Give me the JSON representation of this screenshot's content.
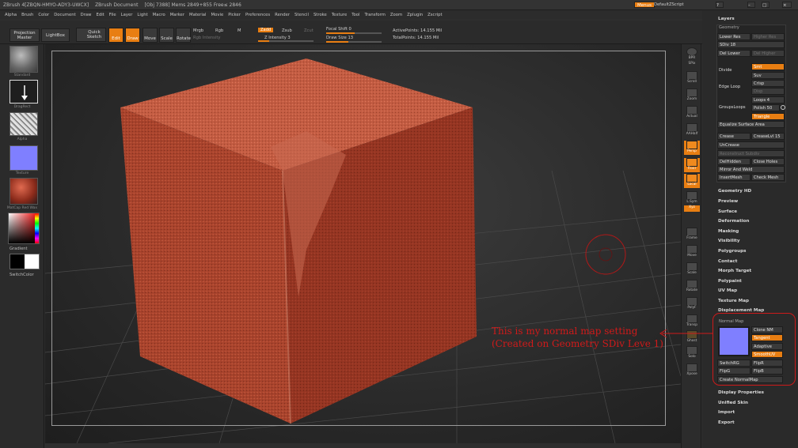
{
  "window": {
    "title_parts": [
      "ZBrush 4[ZBQN-HMYO-ADY3-UWCX]",
      "ZBrush Document",
      "[Obj 7388] Mems 2849+855 Free≤ 2846"
    ]
  },
  "menu": [
    "Alpha",
    "Brush",
    "Color",
    "Document",
    "Draw",
    "Edit",
    "File",
    "Layer",
    "Light",
    "Macro",
    "Marker",
    "Material",
    "Movie",
    "Picker",
    "Preferences",
    "Render",
    "Stencil",
    "Stroke",
    "Texture",
    "Tool",
    "Transform",
    "Zoom",
    "Zplugin",
    "Zscript"
  ],
  "top_right": {
    "menus": "Menus",
    "script": "DefaultZScript"
  },
  "shelf": {
    "projection_master": "Projection Master",
    "lightbox": "LightBox",
    "quick_sketch": "Quick Sketch",
    "edit": "Edit",
    "draw": "Draw",
    "move": "Move",
    "scale": "Scale",
    "rotate": "Rotate",
    "mrgb": "Mrgb",
    "rgb": "Rgb",
    "m": "M",
    "rgb_intensity": "Rgb Intensity",
    "zadd": "Zadd",
    "zsub": "Zsub",
    "zcut": "Zcut",
    "z_intensity": "Z Intensity 3",
    "focal_shift": "Focal Shift 0",
    "draw_size": "Draw Size 13",
    "active_points": "ActivePoints: 14.155 Mil",
    "total_points": "TotalPoints: 14.155 Mil"
  },
  "left_shelf": {
    "brush": "Standard",
    "stroke": "DragRect",
    "alpha": "Alpha",
    "texture": "Texture",
    "material": "MatCap Red Wax",
    "gradient": "Gradient",
    "switch_color": "SwitchColor"
  },
  "right_shelf": [
    "BPR",
    "SPix",
    "Scroll",
    "Zoom",
    "Actual",
    "AAHalf",
    "Persp",
    "Floor",
    "Local",
    "L.Sym",
    "Xyz",
    "Frame",
    "Move",
    "Scale",
    "Rotate",
    "PolyF",
    "Transp",
    "Ghost",
    "Solo",
    "Xpose"
  ],
  "tray": {
    "layers": "Layers",
    "geometry": "Geometry",
    "lower_res": "Lower Res",
    "higher_res": "Higher Res",
    "sdiv": "SDiv 18",
    "del_lower": "Del Lower",
    "del_higher": "Del Higher",
    "divide": "Divide",
    "smt": "Smt",
    "suv": "Suv",
    "edge_loop": "Edge Loop",
    "crisp": "Crisp",
    "disp": "Disp",
    "grouploops": "GroupsLoops",
    "loops": "Loops 4",
    "polish": "Polish 50",
    "triangle": "Triangle",
    "equalize": "Equalize Surface Area",
    "crease": "Crease",
    "creaselvl": "CreaseLvl 15",
    "uncrease": "UnCrease",
    "reconstruct": "Reconstruct Subdiv",
    "delhidden": "DelHidden",
    "closeholes": "Close Holes",
    "mirrorweld": "Mirror And Weld",
    "insertmesh": "InsertMesh",
    "checkmesh": "Check Mesh",
    "sections": [
      "Geometry HD",
      "Preview",
      "Surface",
      "Deformation",
      "Masking",
      "Visibility",
      "Polygroups",
      "Contact",
      "Morph Target",
      "Polypaint",
      "UV Map",
      "Texture Map",
      "Displacement Map"
    ],
    "normal_map": "Normal Map",
    "clone_nm": "Clone NM",
    "tangent": "Tangent",
    "adaptive": "Adaptive",
    "smoothuv": "SmoothUV",
    "switchrg": "SwitchRG",
    "flipr": "FlipR",
    "flipg": "FlipG",
    "flipb": "FlipB",
    "create_nm": "Create NormalMap",
    "sections2": [
      "Display Properties",
      "Unified Skin",
      "Import",
      "Export"
    ]
  },
  "annotation": {
    "line1": "This is my normal map setting",
    "line2": "(Created on Geometry SDiv Leve 1)"
  },
  "colors": {
    "accent": "#e87e12",
    "annotation": "#d01a1a",
    "normal_map": "#7f7fff",
    "clay": "#a8432c"
  }
}
